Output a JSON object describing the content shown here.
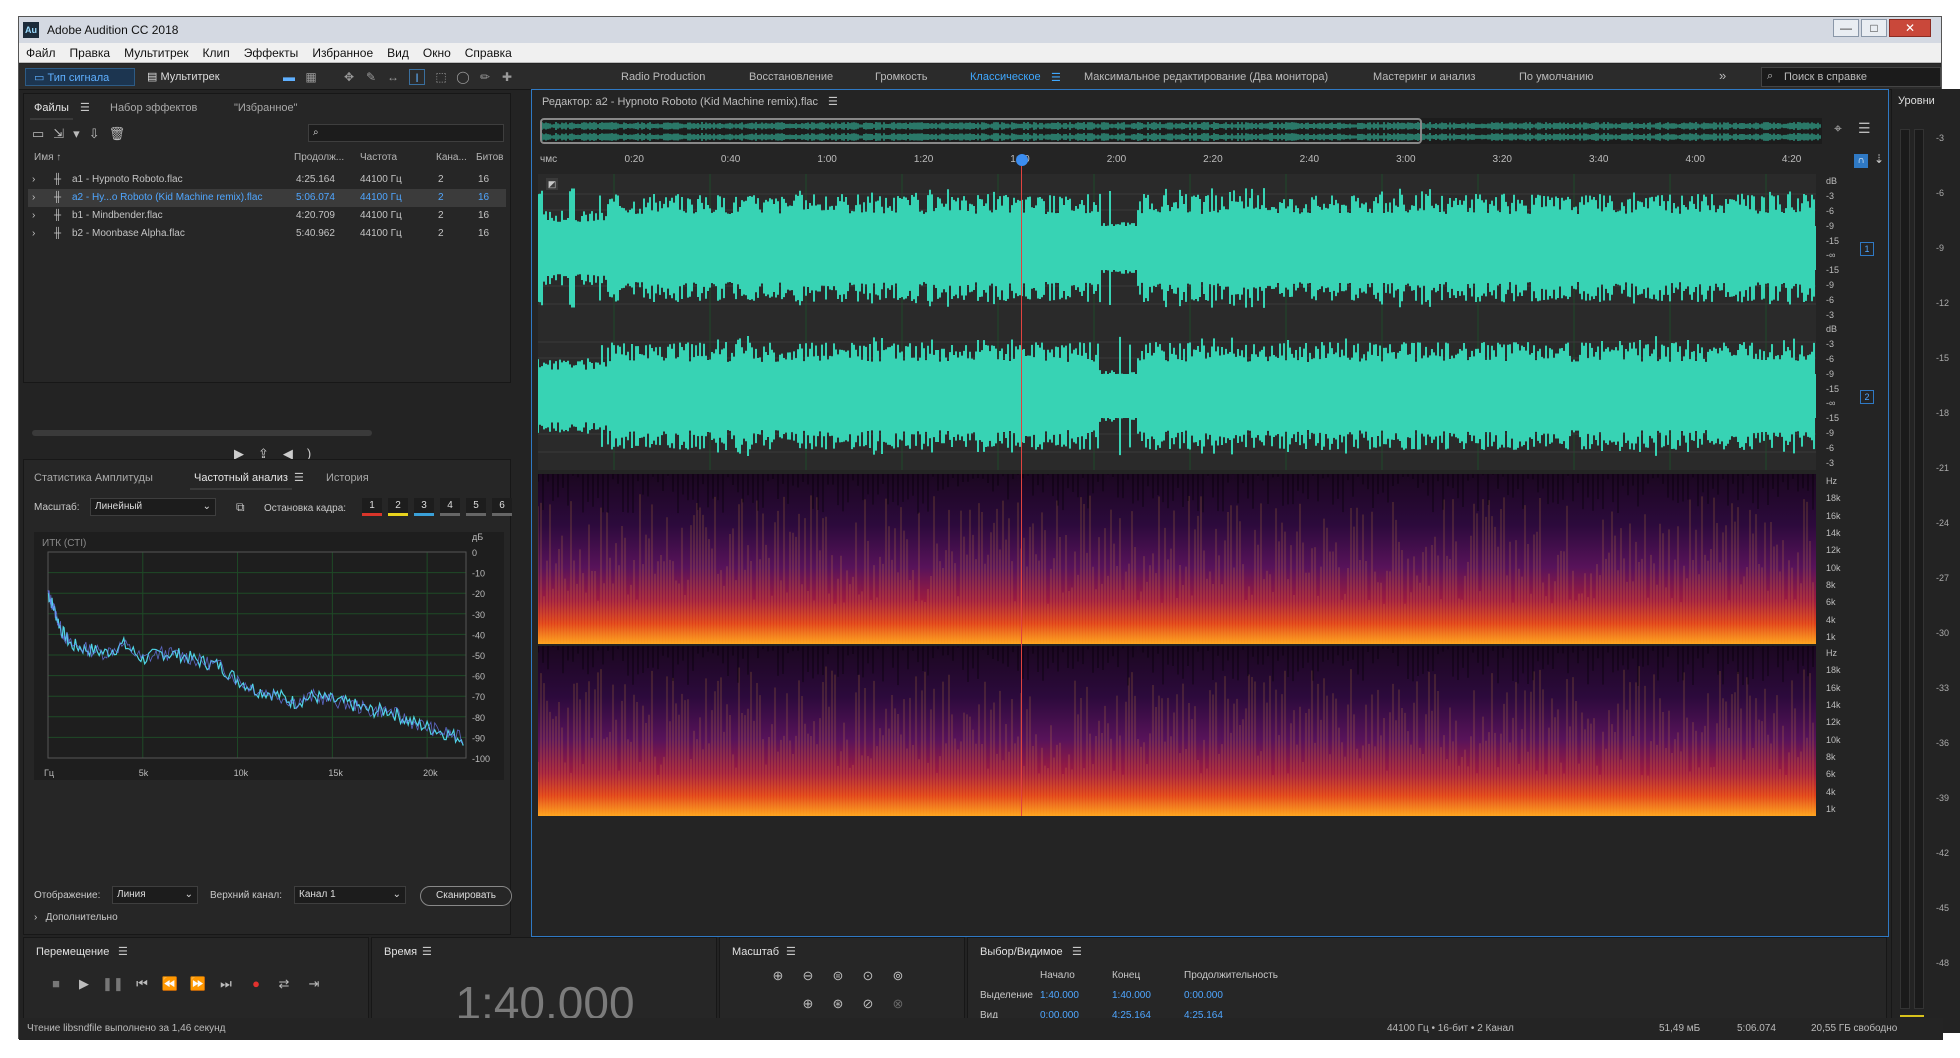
{
  "app": {
    "title": "Adobe Audition CC 2018",
    "logo": "Au"
  },
  "window_controls": {
    "minimize": "—",
    "maximize": "□",
    "close": "✕"
  },
  "menu": [
    "Файл",
    "Правка",
    "Мультитрек",
    "Клип",
    "Эффекты",
    "Избранное",
    "Вид",
    "Окно",
    "Справка"
  ],
  "toolbar": {
    "mode_waveform": "Тип сигнала",
    "mode_multitrack": "Мультитрек",
    "workspaces": [
      "Radio Production",
      "Восстановление",
      "Громкость",
      "Классическое",
      "Максимальное редактирование (Два монитора)",
      "Мастеринг и анализ",
      "По умолчанию"
    ],
    "active_workspace": "Классическое",
    "overflow": "»",
    "search_placeholder": "Поиск в справке"
  },
  "files_panel": {
    "tabs": [
      "Файлы",
      "Набор эффектов",
      "\"Избранное\""
    ],
    "columns": [
      "Имя ↑",
      "Продолж...",
      "Частота",
      "Кана...",
      "Битов"
    ],
    "files": [
      {
        "name": "a1 - Hypnoto Roboto.flac",
        "duration": "4:25.164",
        "rate": "44100 Гц",
        "channels": "2",
        "bits": "16"
      },
      {
        "name": "a2 - Hy...o Roboto (Kid Machine remix).flac",
        "duration": "5:06.074",
        "rate": "44100 Гц",
        "channels": "2",
        "bits": "16"
      },
      {
        "name": "b1 - Mindbender.flac",
        "duration": "4:20.709",
        "rate": "44100 Гц",
        "channels": "2",
        "bits": "16"
      },
      {
        "name": "b2 - Moonbase Alpha.flac",
        "duration": "5:40.962",
        "rate": "44100 Гц",
        "channels": "2",
        "bits": "16"
      }
    ]
  },
  "analysis_panel": {
    "tabs": [
      "Статистика Амплитуды",
      "Частотный анализ",
      "История"
    ],
    "scale_label": "Масштаб:",
    "scale_value": "Линейный",
    "freeze_label": "Остановка кадра:",
    "freeze_slots": [
      "1",
      "2",
      "3",
      "4",
      "5",
      "6"
    ],
    "freeze_colors": [
      "#d9352a",
      "#e8851d",
      "#e8d31d",
      "#59c13a",
      "#3aa0d8",
      "#4ed1e3"
    ],
    "display_label": "Отображение:",
    "display_value": "Линия",
    "channel_label": "Верхний канал:",
    "channel_value": "Канал 1",
    "scan_button": "Сканировать",
    "more": "Дополнительно",
    "chart_title": "ИТК (СТI)"
  },
  "chart_data": {
    "type": "line",
    "title": "ИТК (СТI)",
    "xlabel": "",
    "ylabel": "дБ",
    "x_ticks": [
      "Гц",
      "5k",
      "10k",
      "15k",
      "20k"
    ],
    "y_ticks": [
      "0",
      "-10",
      "-20",
      "-30",
      "-40",
      "-50",
      "-60",
      "-70",
      "-80",
      "-90",
      "-100"
    ],
    "xlim": [
      0,
      22050
    ],
    "ylim": [
      -100,
      0
    ],
    "grid": true,
    "series": [
      {
        "x": [
          0,
          300,
          700,
          1200,
          2000,
          3000,
          4000,
          5000,
          6000,
          7000,
          8000,
          9000,
          10000,
          11000,
          12000,
          13000,
          14000,
          15000,
          16000,
          17000,
          18000,
          19000,
          20000,
          21000,
          22000
        ],
        "values": [
          -20,
          -27,
          -38,
          -45,
          -47,
          -49,
          -45,
          -52,
          -49,
          -50,
          -53,
          -55,
          -62,
          -67,
          -69,
          -73,
          -70,
          -72,
          -74,
          -77,
          -77,
          -82,
          -85,
          -88,
          -91
        ]
      }
    ]
  },
  "editor": {
    "title": "Редактор: a2 - Hypnoto Roboto (Kid Machine remix).flac",
    "timeline_unit": "чмс",
    "timeline": [
      "0:20",
      "0:40",
      "1:00",
      "1:20",
      "1:40",
      "2:00",
      "2:20",
      "2:40",
      "3:00",
      "3:20",
      "3:40",
      "4:00",
      "4:20"
    ],
    "db_scale": [
      "dB",
      "-3",
      "-6",
      "-9",
      "-15",
      "-∞",
      "-15",
      "-9",
      "-6",
      "-3"
    ],
    "channels": [
      "1",
      "2"
    ],
    "hz_scale": [
      "Hz",
      "18k",
      "16k",
      "14k",
      "12k",
      "10k",
      "8k",
      "6k",
      "4k",
      "1k"
    ],
    "playhead": "1:40",
    "total": "5:06.074"
  },
  "meters": {
    "title": "Уровни",
    "marks": [
      "-3",
      "-6",
      "-9",
      "-12",
      "-15",
      "-18",
      "-21",
      "-24",
      "-27",
      "-30",
      "-33",
      "-36",
      "-39",
      "-42",
      "-45",
      "-48"
    ]
  },
  "transport": {
    "title": "Перемещение",
    "buttons": [
      "stop",
      "play",
      "pause",
      "to-start",
      "rewind",
      "forward",
      "to-end",
      "record",
      "loop",
      "skip"
    ]
  },
  "time_panel": {
    "title": "Время",
    "value": "1:40.000"
  },
  "zoom_panel": {
    "title": "Масштаб"
  },
  "selection_panel": {
    "title": "Выбор/Видимое",
    "col_start": "Начало",
    "col_end": "Конец",
    "col_duration": "Продолжительность",
    "rows": [
      {
        "label": "Выделение",
        "start": "1:40.000",
        "end": "1:40.000",
        "duration": "0:00.000"
      },
      {
        "label": "Вид",
        "start": "0:00.000",
        "end": "4:25.164",
        "duration": "4:25.164"
      }
    ]
  },
  "status": {
    "message": "Чтение libsndfile выполнено за 1,46 секунд",
    "format": "44100 Гц • 16-бит • 2 Канал",
    "size": "51,49 мБ",
    "length": "5:06.074",
    "free": "20,55 ГБ свободно"
  },
  "colors": {
    "waveform": "#37d3b4",
    "accent": "#3fa8ff",
    "playhead": "#e0433f"
  }
}
